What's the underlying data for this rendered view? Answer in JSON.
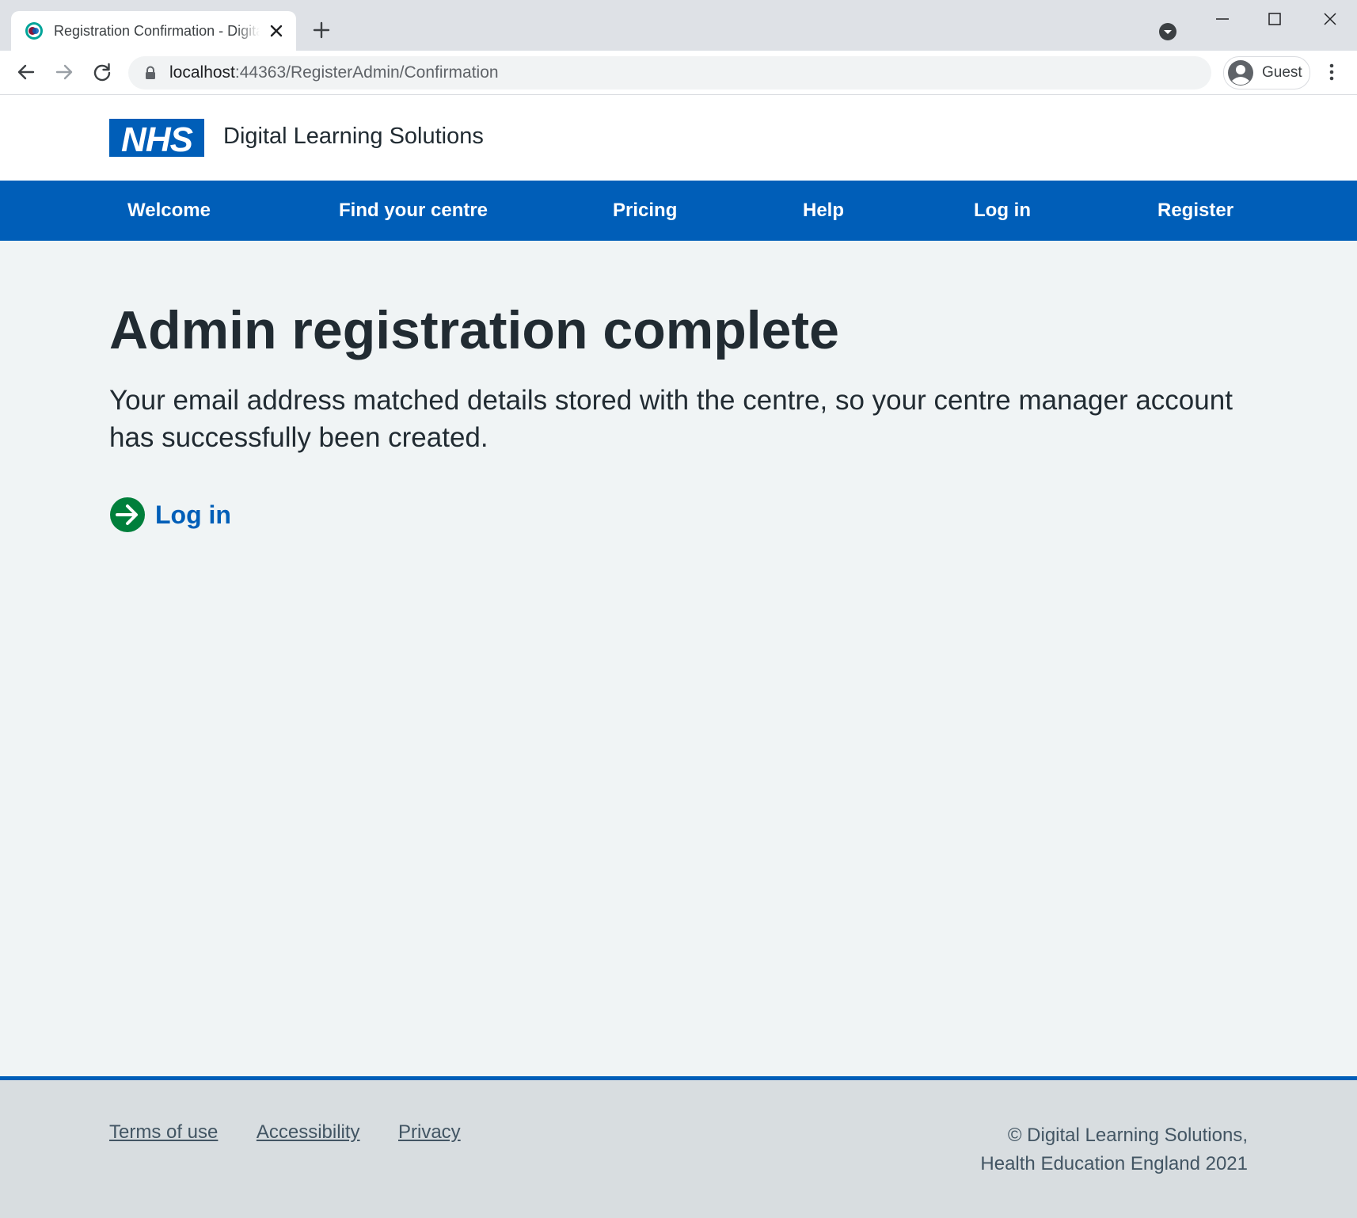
{
  "browser": {
    "tab_title": "Registration Confirmation - Digital Learning Solutions",
    "url_host": "localhost",
    "url_rest": ":44363/RegisterAdmin/Confirmation",
    "profile_name": "Guest",
    "icons": [
      "favicon-icon",
      "close-icon",
      "plus-icon",
      "tab-search-icon",
      "minimize-icon",
      "maximize-icon",
      "window-close-icon",
      "back-arrow-icon",
      "forward-arrow-icon",
      "reload-icon",
      "lock-icon",
      "profile-avatar-icon",
      "more-menu-icon"
    ]
  },
  "header": {
    "logo_text": "NHS",
    "service_name": "Digital Learning Solutions"
  },
  "nav": {
    "items": [
      {
        "label": "Welcome"
      },
      {
        "label": "Find your centre"
      },
      {
        "label": "Pricing"
      },
      {
        "label": "Help"
      },
      {
        "label": "Log in"
      },
      {
        "label": "Register"
      }
    ]
  },
  "main": {
    "title": "Admin registration complete",
    "lead": "Your email address matched details stored with the centre, so your centre manager account has successfully been created.",
    "action_link": "Log in"
  },
  "footer": {
    "links": [
      {
        "label": "Terms of use"
      },
      {
        "label": "Accessibility"
      },
      {
        "label": "Privacy"
      }
    ],
    "copyright_line1": "© Digital Learning Solutions,",
    "copyright_line2": "Health Education England 2021"
  },
  "colors": {
    "nhs_blue": "#005eb8",
    "page_background": "#f0f4f5",
    "action_green": "#007f3b",
    "footer_background": "#d8dde0",
    "text": "#212b32"
  }
}
